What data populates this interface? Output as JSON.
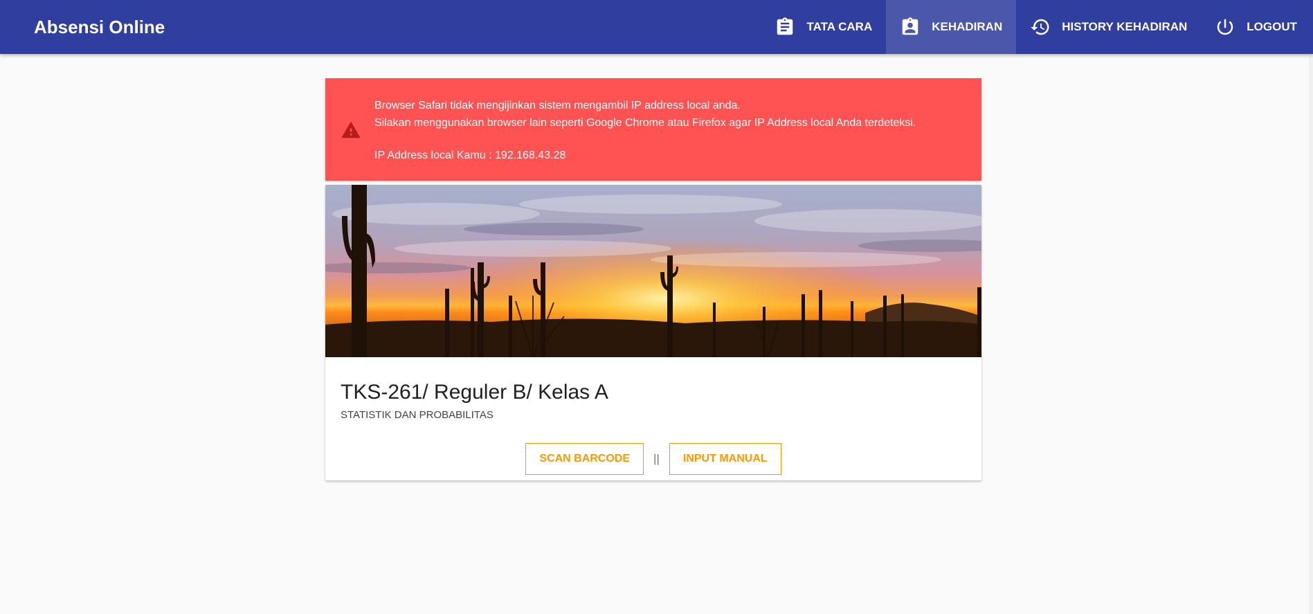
{
  "app": {
    "title": "Absensi Online"
  },
  "nav": {
    "items": [
      {
        "label": "TATA CARA",
        "icon": "clipboard-icon"
      },
      {
        "label": "KEHADIRAN",
        "icon": "assignment-ind-icon",
        "active": true
      },
      {
        "label": "HISTORY KEHADIRAN",
        "icon": "history-icon"
      },
      {
        "label": "LOGOUT",
        "icon": "power-icon"
      }
    ]
  },
  "alert": {
    "icon": "warning-icon",
    "line1": "Browser Safari tidak mengijinkan sistem mengambil IP address local anda.",
    "line2": "Silakan menggunakan browser lain seperti Google Chrome atau Firefox agar IP Address local Anda terdeteksi.",
    "line3": "IP Address local Kamu : 192.168.43.28"
  },
  "course": {
    "title": "TKS-261/ Reguler B/ Kelas A",
    "subtitle": "STATISTIK DAN PROBABILITAS"
  },
  "actions": {
    "scan_label": "SCAN BARCODE",
    "separator": "||",
    "manual_label": "INPUT MANUAL"
  },
  "colors": {
    "primary": "#303f9f",
    "alert": "#ff5252",
    "accent": "#ff9800",
    "background": "#fafafa"
  }
}
